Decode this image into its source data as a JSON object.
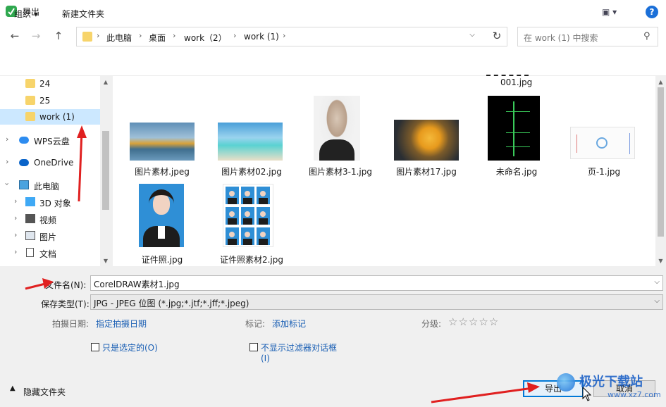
{
  "window": {
    "title": "导出",
    "close": "✕"
  },
  "nav": {
    "back": "←",
    "forward": "→",
    "up": "↑"
  },
  "address": {
    "crumbs": [
      "此电脑",
      "桌面",
      "work（2）",
      "work (1)"
    ],
    "sep": "›",
    "dropdown": "⌵",
    "refresh": "↻"
  },
  "search": {
    "placeholder": "在 work (1) 中搜索"
  },
  "toolbar": {
    "organize": "组织 ▾",
    "new_folder": "新建文件夹",
    "view": "▣ ▾",
    "help": "?"
  },
  "sidebar": {
    "items": [
      {
        "label": "24"
      },
      {
        "label": "25"
      },
      {
        "label": "work (1)"
      },
      {
        "label": "WPS云盘"
      },
      {
        "label": "OneDrive"
      },
      {
        "label": "此电脑"
      },
      {
        "label": "3D 对象"
      },
      {
        "label": "视频"
      },
      {
        "label": "图片"
      },
      {
        "label": "文档"
      }
    ]
  },
  "files": {
    "partial": "001.jpg",
    "items": [
      {
        "name": "图片素材.jpeg"
      },
      {
        "name": "图片素材02.jpg"
      },
      {
        "name": "图片素材3-1.jpg"
      },
      {
        "name": "图片素材17.jpg"
      },
      {
        "name": "未命名.jpg"
      },
      {
        "name": "页-1.jpg"
      },
      {
        "name": "证件照.jpg"
      },
      {
        "name": "证件照素材2.jpg"
      }
    ]
  },
  "form": {
    "filename_label": "文件名(N):",
    "filename_value": "CorelDRAW素材1.jpg",
    "type_label": "保存类型(T):",
    "type_value": "JPG - JPEG 位图 (*.jpg;*.jtf;*.jff;*.jpeg)",
    "date_label": "拍摄日期:",
    "date_link": "指定拍摄日期",
    "tags_label": "标记:",
    "tags_link": "添加标记",
    "rating_label": "分级:",
    "rating_stars": "☆☆☆☆☆",
    "opt_selected": "只是选定的(O)",
    "opt_nofilter": "不显示过滤器对话框",
    "opt_nofilter_key": "(I)",
    "hide_folders": "隐藏文件夹",
    "export_btn": "导出",
    "cancel_btn": "取消",
    "watermark": "极光下载站",
    "watermark_url": "www.xz7.com"
  },
  "colors": {
    "accent": "#0078d7",
    "selected": "#cce8ff",
    "link": "#1a5fb4",
    "annotation": "#e02020"
  }
}
